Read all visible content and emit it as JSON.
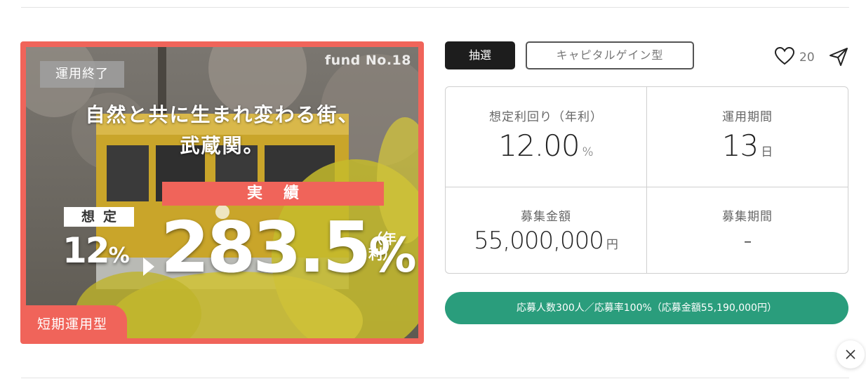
{
  "banner": {
    "status": "運用終了",
    "fund_no": "fund No.18",
    "headline_line1": "自然と共に生まれ変わる街、",
    "headline_line2": "武蔵関。",
    "result_label": "実績",
    "assumed_label": "想定",
    "assumed_value": "12",
    "assumed_unit": "%",
    "actual_value": "283.5",
    "actual_unit": "%",
    "per_year": "（年利）",
    "short_term_tag": "短期運用型"
  },
  "tags": {
    "lottery": "抽選",
    "type": "キャピタルゲイン型"
  },
  "favorite": {
    "count": "20"
  },
  "stats": {
    "yield_label": "想定利回り（年利）",
    "yield_value": "12.00",
    "yield_unit": "%",
    "period_label": "運用期間",
    "period_value": "13",
    "period_unit": "日",
    "amount_label": "募集金額",
    "amount_value": "55,000,000",
    "amount_unit": "円",
    "recruit_label": "募集期間",
    "recruit_value": "-"
  },
  "status_bar": {
    "text": "応募人数300人／応募率100%（応募金額55,190,000円）"
  },
  "colors": {
    "accent_red": "#f0645a",
    "status_green": "#2a9d7c",
    "dark_tag": "#1d1d1d"
  },
  "icons": {
    "favorite": "heart-icon",
    "share": "send-icon",
    "close": "close-icon"
  }
}
